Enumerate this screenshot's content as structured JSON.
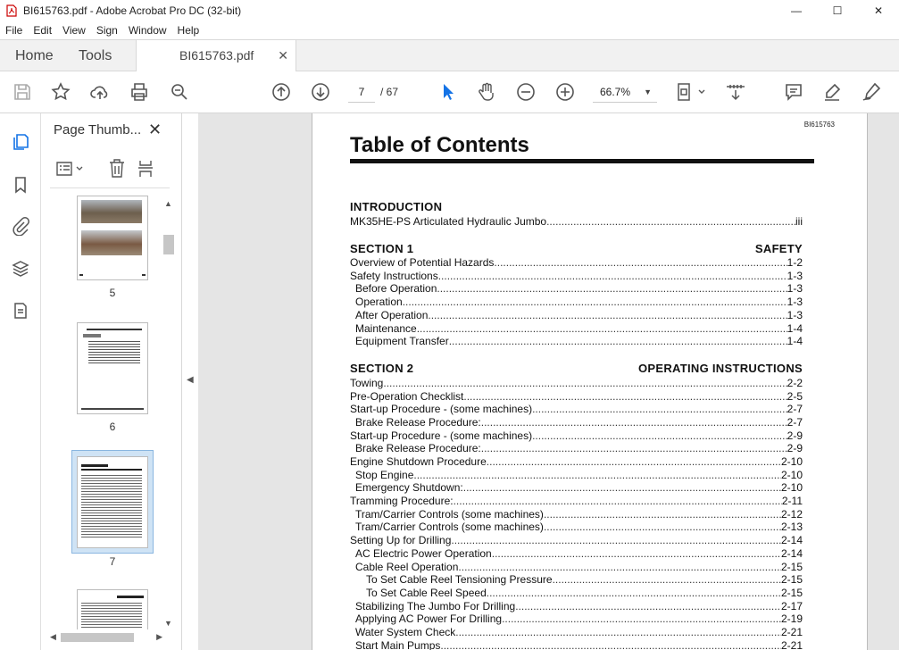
{
  "window": {
    "title": "BI615763.pdf - Adobe Acrobat Pro DC (32-bit)"
  },
  "menu": [
    "File",
    "Edit",
    "View",
    "Sign",
    "Window",
    "Help"
  ],
  "tabs": {
    "home": "Home",
    "tools": "Tools",
    "document": "BI615763.pdf"
  },
  "toolbar": {
    "current_page": "7",
    "page_total": "/ 67",
    "zoom": "66.7%"
  },
  "sidebar": {
    "title": "Page Thumb...",
    "thumbnails": [
      {
        "label": "5"
      },
      {
        "label": "6"
      },
      {
        "label": "7",
        "selected": true
      }
    ]
  },
  "document": {
    "doc_id": "BI615763",
    "title": "Table of Contents",
    "intro": {
      "heading": "INTRODUCTION",
      "entry": {
        "text": "MK35HE-PS  Articulated Hydraulic Jumbo",
        "page": "iii"
      }
    },
    "section1": {
      "heading_left": "SECTION  1",
      "heading_right": "SAFETY",
      "entries": [
        {
          "text": "Overview of Potential Hazards",
          "page": "1-2",
          "indent": 0
        },
        {
          "text": "Safety Instructions",
          "page": "1-3",
          "indent": 0
        },
        {
          "text": "Before Operation",
          "page": "1-3",
          "indent": 1
        },
        {
          "text": "Operation",
          "page": "1-3",
          "indent": 1
        },
        {
          "text": "After Operation",
          "page": "1-3",
          "indent": 1
        },
        {
          "text": "Maintenance",
          "page": "1-4",
          "indent": 1
        },
        {
          "text": "Equipment Transfer",
          "page": "1-4",
          "indent": 1
        }
      ]
    },
    "section2": {
      "heading_left": "SECTION  2",
      "heading_right": "OPERATING  INSTRUCTIONS",
      "entries": [
        {
          "text": "Towing",
          "page": "2-2",
          "indent": 0
        },
        {
          "text": "Pre-Operation Checklist",
          "page": "2-5",
          "indent": 0
        },
        {
          "text": "Start-up Procedure - (some machines)",
          "page": "2-7",
          "indent": 0
        },
        {
          "text": "Brake Release Procedure:",
          "page": "2-7",
          "indent": 1
        },
        {
          "text": "Start-up Procedure - (some machines)",
          "page": "2-9",
          "indent": 0
        },
        {
          "text": "Brake Release Procedure:",
          "page": "2-9",
          "indent": 1
        },
        {
          "text": "Engine Shutdown Procedure",
          "page": "2-10",
          "indent": 0
        },
        {
          "text": "Stop Engine",
          "page": "2-10",
          "indent": 1
        },
        {
          "text": "Emergency Shutdown:",
          "page": "2-10",
          "indent": 1
        },
        {
          "text": "Tramming Procedure:",
          "page": "2-11",
          "indent": 0
        },
        {
          "text": "Tram/Carrier Controls (some machines)",
          "page": "2-12",
          "indent": 1
        },
        {
          "text": "Tram/Carrier Controls (some machines)",
          "page": "2-13",
          "indent": 1
        },
        {
          "text": "Setting Up for Drilling",
          "page": "2-14",
          "indent": 0
        },
        {
          "text": "AC Electric Power Operation",
          "page": "2-14",
          "indent": 1
        },
        {
          "text": "Cable Reel Operation",
          "page": "2-15",
          "indent": 1
        },
        {
          "text": "To Set Cable Reel Tensioning Pressure",
          "page": "2-15",
          "indent": 2
        },
        {
          "text": "To Set Cable Reel Speed",
          "page": "2-15",
          "indent": 2
        },
        {
          "text": "Stabilizing The Jumbo For Drilling",
          "page": "2-17",
          "indent": 1
        },
        {
          "text": "Applying  AC Power For Drilling",
          "page": "2-19",
          "indent": 1
        },
        {
          "text": "Water System Check",
          "page": "2-21",
          "indent": 1
        },
        {
          "text": "Start Main Pumps",
          "page": "2-21",
          "indent": 1
        }
      ]
    }
  }
}
